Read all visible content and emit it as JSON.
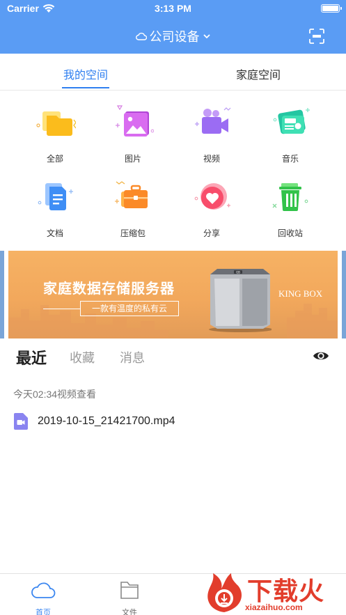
{
  "status_bar": {
    "carrier": "Carrier",
    "time": "3:13 PM"
  },
  "header": {
    "device": "公司设备",
    "icons": {
      "cloud": "cloud-icon",
      "dropdown": "chevron-down-icon",
      "scan": "scan-icon"
    }
  },
  "space_tabs": [
    {
      "label": "我的空间",
      "active": true
    },
    {
      "label": "家庭空间",
      "active": false
    }
  ],
  "categories": [
    {
      "label": "全部",
      "icon": "folder-icon"
    },
    {
      "label": "图片",
      "icon": "image-icon"
    },
    {
      "label": "视频",
      "icon": "video-icon"
    },
    {
      "label": "音乐",
      "icon": "radio-icon"
    },
    {
      "label": "文档",
      "icon": "document-icon"
    },
    {
      "label": "压缩包",
      "icon": "briefcase-icon"
    },
    {
      "label": "分享",
      "icon": "heart-icon"
    },
    {
      "label": "回收站",
      "icon": "trash-icon"
    }
  ],
  "banner": {
    "title": "家庭数据存储服务器",
    "subtitle": "一款有温度的私有云",
    "brand": "KING BOX",
    "device_badge": "GB"
  },
  "recent_tabs": [
    {
      "label": "最近",
      "active": true
    },
    {
      "label": "收藏",
      "active": false
    },
    {
      "label": "消息",
      "active": false
    }
  ],
  "recent": {
    "group_label": "今天02:34视频查看",
    "files": [
      {
        "name": "2019-10-15_21421700.mp4",
        "icon": "video-file-icon"
      }
    ]
  },
  "bottom_nav": [
    {
      "label": "首页",
      "icon": "cloud-icon",
      "active": true
    },
    {
      "label": "文件",
      "icon": "folder-icon",
      "active": false
    }
  ],
  "watermark": {
    "text": "下载火",
    "url": "xiazaihuo.com"
  },
  "colors": {
    "header": "#5a9cf4",
    "accent": "#2f7ff0",
    "banner": "#f2a85c",
    "watermark": "#e23d2c"
  }
}
